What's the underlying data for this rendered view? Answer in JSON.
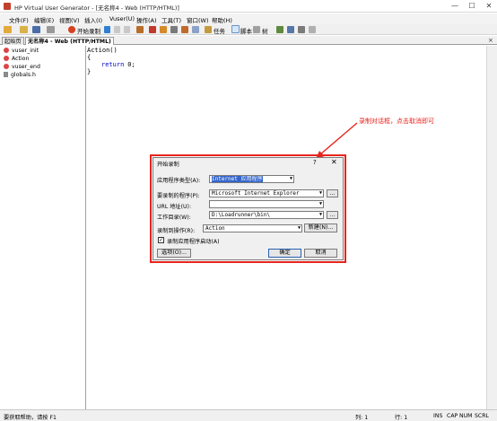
{
  "window": {
    "title": "HP Virtual User Generator - [无名称4 - Web (HTTP/HTML)]",
    "minimize": "—",
    "maximize": "☐",
    "close": "✕"
  },
  "menu": [
    "文件(F)",
    "编辑(E)",
    "视图(V)",
    "插入(I)",
    "Vuser(U)",
    "操作(A)",
    "工具(T)",
    "窗口(W)",
    "帮助(H)"
  ],
  "toolbar": {
    "start_record": "开始录制",
    "task": "任务",
    "script": "脚本",
    "tree": "树"
  },
  "tabs": {
    "start_page": "起始页",
    "script_tab": "无名称4 - Web (HTTP/HTML)",
    "close_symbol": "×"
  },
  "tree": [
    "vuser_init",
    "Action",
    "vuser_end",
    "globals.h"
  ],
  "code": {
    "line1": "Action()",
    "line2": "{",
    "line3_kw": "return",
    "line3_rest": " 0;",
    "line4": "}"
  },
  "annotation": "录制对话框，点击取消即可",
  "dialog": {
    "title": "开始录制",
    "help": "?",
    "close": "✕",
    "app_type_label": "应用程序类型(A):",
    "app_type_value": "Internet 应用程序",
    "program_label": "要录制的程序(P):",
    "program_value": "Microsoft Internet Explorer",
    "url_label": "URL 地址(U):",
    "url_value": "",
    "workdir_label": "工作目录(W):",
    "workdir_value": "D:\\Loadrunner\\bin\\",
    "record_into_label": "录制到操作(R):",
    "record_into_value": "Action",
    "new_button": "新建(N)...",
    "browse": "...",
    "autostart_label": "录制应用程序启动(A)",
    "autostart_checked": true,
    "options_button": "选项(O)...",
    "ok_button": "确定",
    "cancel_button": "取消"
  },
  "status": {
    "help": "要获取帮助，请按 F1",
    "row": "列: 1",
    "col": "行: 1",
    "ins": "INS",
    "cap": "CAP",
    "num": "NUM",
    "scrl": "SCRL"
  }
}
